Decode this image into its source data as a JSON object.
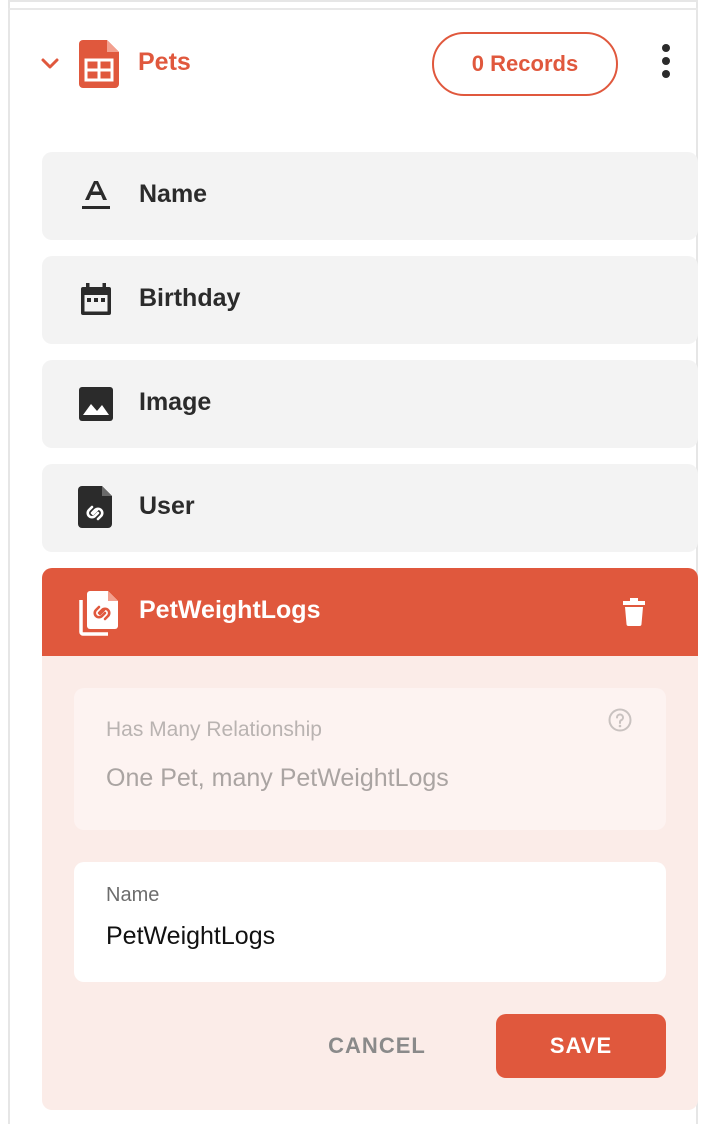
{
  "header": {
    "title": "Pets",
    "records_label": "0 Records",
    "icons": {
      "collapse": "chevron-down-icon",
      "table": "table-icon",
      "more": "kebab-icon"
    }
  },
  "fields": [
    {
      "label": "Name",
      "icon": "text-icon"
    },
    {
      "label": "Birthday",
      "icon": "calendar-icon"
    },
    {
      "label": "Image",
      "icon": "image-icon"
    },
    {
      "label": "User",
      "icon": "link-file-icon"
    }
  ],
  "active_field": {
    "label": "PetWeightLogs",
    "icon": "link-files-icon",
    "delete_icon": "trash-icon",
    "relationship": {
      "title": "Has Many Relationship",
      "value": "One Pet, many PetWeightLogs"
    },
    "name_field": {
      "label": "Name",
      "value": "PetWeightLogs"
    },
    "cancel_label": "CANCEL",
    "save_label": "SAVE"
  },
  "colors": {
    "accent": "#e0583d",
    "field_bg": "#f3f3f3",
    "active_bg": "#fbece8"
  }
}
